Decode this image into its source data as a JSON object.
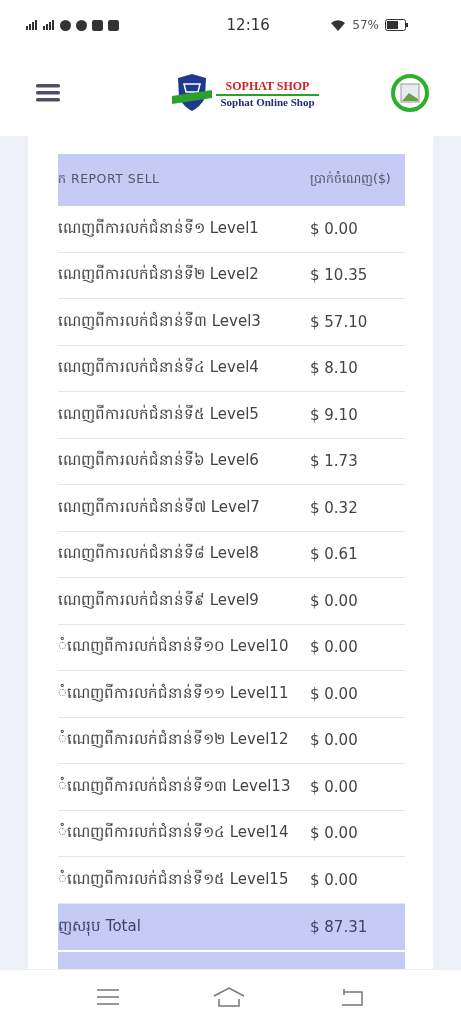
{
  "status_bar": {
    "time": "12:16",
    "battery": "57%"
  },
  "header": {
    "brand": "SOPHAT SHOP",
    "subtitle": "Sophat Online Shop"
  },
  "table": {
    "columns": [
      "ក REPORT SELL",
      "ប្រាក់ចំណេញ($)"
    ],
    "rows": [
      {
        "label": "ណេញពីការលក់ជំនាន់ទី១ Level1",
        "amount": "$ 0.00"
      },
      {
        "label": "ណេញពីការលក់ជំនាន់ទី២ Level2",
        "amount": "$ 10.35"
      },
      {
        "label": "ណេញពីការលក់ជំនាន់ទី៣ Level3",
        "amount": "$ 57.10"
      },
      {
        "label": "ណេញពីការលក់ជំនាន់ទី៤ Level4",
        "amount": "$ 8.10"
      },
      {
        "label": "ណេញពីការលក់ជំនាន់ទី៥ Level5",
        "amount": "$ 9.10"
      },
      {
        "label": "ណេញពីការលក់ជំនាន់ទី៦ Level6",
        "amount": "$ 1.73"
      },
      {
        "label": "ណេញពីការលក់ជំនាន់ទី៧ Level7",
        "amount": "$ 0.32"
      },
      {
        "label": "ណេញពីការលក់ជំនាន់ទី៨ Level8",
        "amount": "$ 0.61"
      },
      {
        "label": "ណេញពីការលក់ជំនាន់ទី៩ Level9",
        "amount": "$ 0.00"
      },
      {
        "label": "ំណេញពីការលក់ជំនាន់ទី១០ Level10",
        "amount": "$ 0.00"
      },
      {
        "label": "ំណេញពីការលក់ជំនាន់ទី១១ Level11",
        "amount": "$ 0.00"
      },
      {
        "label": "ំណេញពីការលក់ជំនាន់ទី១២ Level12",
        "amount": "$ 0.00"
      },
      {
        "label": "ំណេញពីការលក់ជំនាន់ទី១៣ Level13",
        "amount": "$ 0.00"
      },
      {
        "label": "ំណេញពីការលក់ជំនាន់ទី១៤ Level14",
        "amount": "$ 0.00"
      },
      {
        "label": "ំណេញពីការលក់ជំនាន់ទី១៥ Level15",
        "amount": "$ 0.00"
      }
    ],
    "total": {
      "label": "ញសរុប Total",
      "amount": "$ 87.31"
    }
  }
}
